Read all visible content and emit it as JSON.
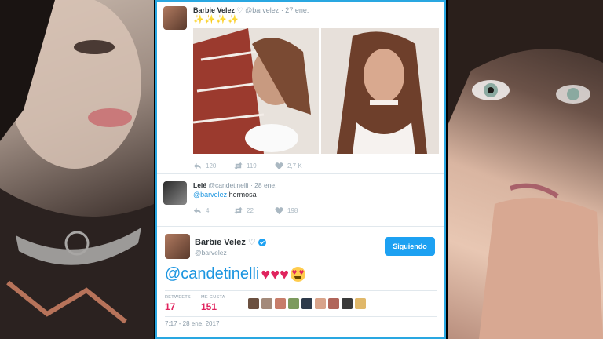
{
  "tweet1": {
    "name": "Barbie Velez",
    "heart": "♡",
    "handle": "@barvelez",
    "date": "· 27 ene.",
    "emoji_text": "✨✨✨✨",
    "reply_count": "120",
    "retweet_count": "119",
    "like_count": "2,7 K"
  },
  "tweet2": {
    "name": "Lelé",
    "handle": "@candetinelli",
    "date": "· 28 ene.",
    "mention": "@barvelez",
    "text": " hermosa",
    "reply_count": "4",
    "retweet_count": "22",
    "like_count": "198"
  },
  "tweet3": {
    "name": "Barbie Velez",
    "heart": "♡",
    "handle": "@barvelez",
    "follow_label": "Siguiendo",
    "mention": "@candetinelli",
    "hearts": "♥♥♥",
    "retweets_label": "RETWEETS",
    "retweets_value": "17",
    "likes_label": "ME GUSTA",
    "likes_value": "151",
    "timestamp": "7:17 - 28 ene. 2017"
  },
  "colors": {
    "accent": "#1da1f2",
    "border": "#29a7e1",
    "like": "#e0245e"
  },
  "icons": [
    "reply-icon",
    "retweet-icon",
    "like-icon",
    "verified-icon"
  ]
}
